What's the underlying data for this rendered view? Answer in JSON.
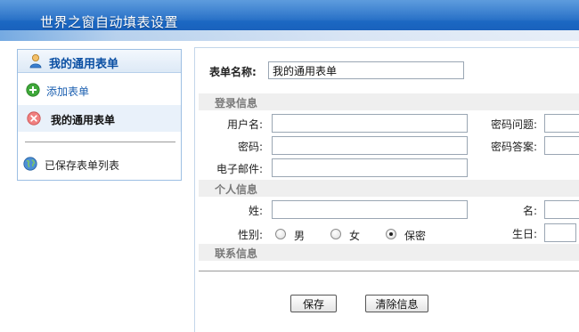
{
  "header": {
    "title": "世界之窗自动填表设置"
  },
  "sidebar": {
    "title": "我的通用表单",
    "items": [
      {
        "label": "添加表单",
        "icon": "plus-icon"
      },
      {
        "label": "我的通用表单",
        "icon": "remove-icon"
      },
      {
        "label": "已保存表单列表",
        "icon": "globe-icon"
      }
    ]
  },
  "form": {
    "name_label": "表单名称:",
    "name_value": "我的通用表单",
    "sections": {
      "login": {
        "title": "登录信息",
        "username_label": "用户名:",
        "password_label": "密码:",
        "email_label": "电子邮件:",
        "question_label": "密码问题:",
        "answer_label": "密码答案:"
      },
      "personal": {
        "title": "个人信息",
        "surname_label": "姓:",
        "given_name_label": "名:",
        "gender_label": "性别:",
        "gender_options": [
          "男",
          "女",
          "保密"
        ],
        "gender_selected": "保密",
        "birthday_label": "生日:"
      },
      "contact": {
        "title": "联系信息"
      }
    }
  },
  "buttons": {
    "save": "保存",
    "clear": "清除信息"
  },
  "colors": {
    "header": "#1b67c2",
    "link": "#1b5fb0",
    "sidebar_title": "#0a4fa3"
  }
}
